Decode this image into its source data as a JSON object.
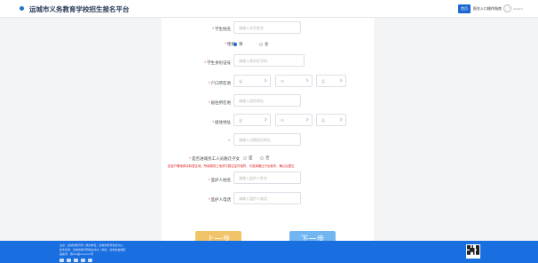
{
  "header": {
    "title": "运城市义务教育学校招生报名平台",
    "nav": [
      "首页",
      "报名入口",
      "操作指南"
    ],
    "user": "(hidden)"
  },
  "form": {
    "student_name": {
      "label": "学生姓名",
      "placeholder": "请输入学生姓名"
    },
    "gender": {
      "label": "性别",
      "options": [
        "男",
        "女"
      ],
      "selected": "男"
    },
    "id_number": {
      "label": "学生身份证号",
      "placeholder": "请输入身份证号码"
    },
    "hukou": {
      "label": "户口所在地",
      "selects": [
        "省",
        "市",
        "县"
      ]
    },
    "hukou_detail": {
      "placeholder": "请输入详细地址"
    },
    "household": {
      "label": "居住所在地",
      "placeholder": "请输入居住地址"
    },
    "residence": {
      "label": "居住地址",
      "selects": [
        "省",
        "市",
        "县"
      ]
    },
    "residence_detail": {
      "placeholder": "请输入详细居住地址"
    },
    "migrant": {
      "label": "是否进城务工人员随迁子女",
      "options": [
        "是",
        "否"
      ]
    },
    "notice": "如该户籍地和实际居住地，所填报务工地须与暂住证件相符，可选择随迁子女就学，确认后提交",
    "guardian_name": {
      "label": "监护人姓名",
      "placeholder": "请输入监护人姓名"
    },
    "guardian_phone": {
      "label": "监护人电话",
      "placeholder": "请输入监护人电话"
    }
  },
  "buttons": {
    "prev": "上一步",
    "next": "下一步"
  },
  "footer": {
    "lines": [
      "主办：运城市教育局 | 承办单位：运城市教育信息中心",
      "技术支持：运城市教育局信息中心 | 地址：运城市盐湖区",
      "备案号：晋ICP备xxxxxxxx号"
    ]
  },
  "colors": {
    "primary": "#1a66d2",
    "footer": "#1a6fe0",
    "prev_button": "#f2c46a",
    "next_button": "#72b6f1",
    "required": "#e02020"
  }
}
